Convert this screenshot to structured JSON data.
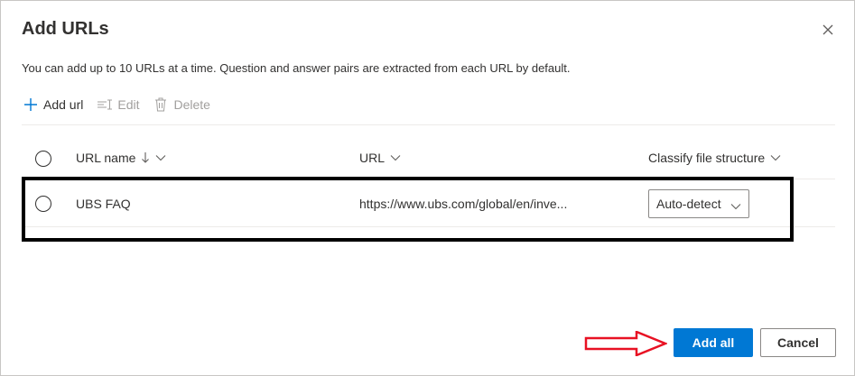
{
  "dialog": {
    "title": "Add URLs",
    "description": "You can add up to 10 URLs at a time. Question and answer pairs are extracted from each URL by default."
  },
  "toolbar": {
    "add_label": "Add url",
    "edit_label": "Edit",
    "delete_label": "Delete"
  },
  "table": {
    "columns": [
      {
        "label": "URL name",
        "sort": "descending"
      },
      {
        "label": "URL"
      },
      {
        "label": "Classify file structure"
      }
    ],
    "rows": [
      {
        "name": "UBS FAQ",
        "url": "https://www.ubs.com/global/en/inve...",
        "classify": "Auto-detect"
      }
    ]
  },
  "footer": {
    "primary_label": "Add all",
    "secondary_label": "Cancel"
  },
  "colors": {
    "accent": "#0078d4",
    "annotation_arrow": "#e81123",
    "highlight_box": "#000000"
  },
  "icons": [
    "close-icon",
    "plus-icon",
    "edit-icon",
    "trash-icon",
    "sort-down-arrow-icon",
    "chevron-down-icon"
  ]
}
